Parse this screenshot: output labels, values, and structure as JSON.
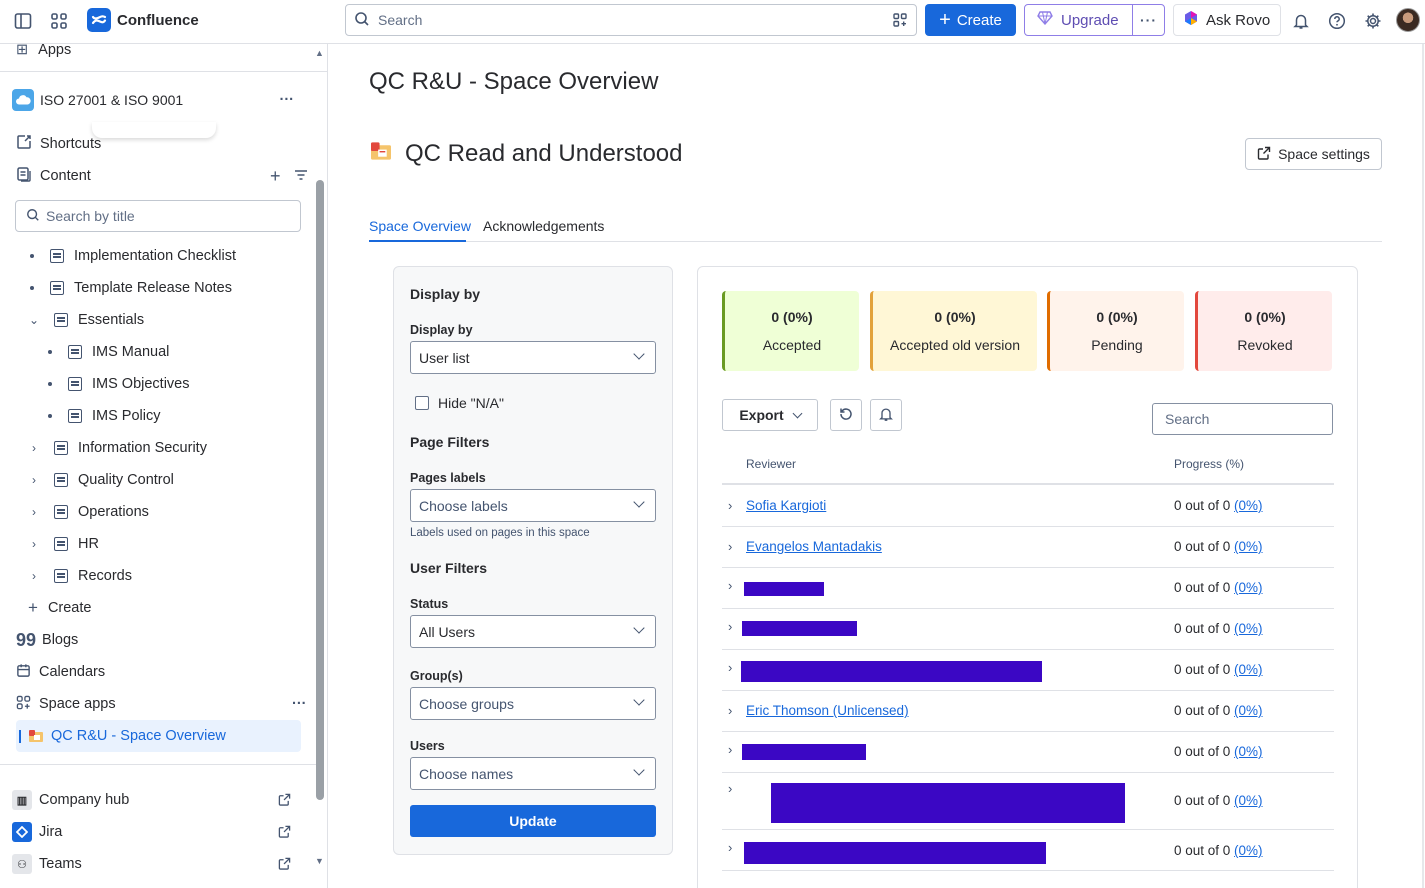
{
  "topbar": {
    "app_name": "Confluence",
    "search_placeholder": "Search",
    "create_label": "Create",
    "upgrade_label": "Upgrade",
    "more_label": "···",
    "rovo_label": "Ask Rovo"
  },
  "sidebar": {
    "apps_label": "Apps",
    "space_name": "ISO 27001 & ISO 9001",
    "space_more": "···",
    "shortcuts": "Shortcuts",
    "content": "Content",
    "search_placeholder": "Search by title",
    "tree": [
      {
        "label": "Implementation Checklist"
      },
      {
        "label": "Template Release Notes"
      },
      {
        "label": "Essentials"
      },
      {
        "label": "IMS Manual"
      },
      {
        "label": "IMS Objectives"
      },
      {
        "label": "IMS Policy"
      },
      {
        "label": "Information Security"
      },
      {
        "label": "Quality Control"
      },
      {
        "label": "Operations"
      },
      {
        "label": "HR"
      },
      {
        "label": "Records"
      }
    ],
    "create": "Create",
    "blogs": "Blogs",
    "calendars": "Calendars",
    "space_apps": "Space apps",
    "space_apps_more": "···",
    "active_item": "QC R&U - Space Overview",
    "company_hub": "Company hub",
    "jira": "Jira",
    "teams": "Teams"
  },
  "main": {
    "page_title": "QC R&U - Space Overview",
    "section_title": "QC Read and Understood",
    "space_settings": "Space settings",
    "tabs": [
      "Space Overview",
      "Acknowledgements"
    ],
    "active_tab": 0
  },
  "filters": {
    "heading": "Display by",
    "display_by_label": "Display by",
    "display_by_value": "User list",
    "hide_na": "Hide \"N/A\"",
    "page_filters": "Page Filters",
    "pages_labels": "Pages labels",
    "pages_labels_ph": "Choose labels",
    "labels_help": "Labels used on pages in this space",
    "user_filters": "User Filters",
    "status_label": "Status",
    "status_value": "All Users",
    "groups_label": "Group(s)",
    "groups_ph": "Choose groups",
    "users_label": "Users",
    "users_ph": "Choose names",
    "update": "Update"
  },
  "stats": [
    {
      "value": "0 (0%)",
      "label": "Accepted",
      "bg": "#efffd6",
      "border": "#6a9a23"
    },
    {
      "value": "0 (0%)",
      "label": "Accepted old version",
      "bg": "#fff7d6",
      "border": "#e2a23b"
    },
    {
      "value": "0 (0%)",
      "label": "Pending",
      "bg": "#fff3eb",
      "border": "#e06c00"
    },
    {
      "value": "0 (0%)",
      "label": "Revoked",
      "bg": "#ffeceb",
      "border": "#e2483d"
    }
  ],
  "toolbar": {
    "export": "Export",
    "search_placeholder": "Search"
  },
  "table": {
    "col_reviewer": "Reviewer",
    "col_progress": "Progress (%)",
    "rows": [
      {
        "name": "Sofia Kargioti",
        "progress": "0 out of 0 ",
        "pct": "(0%)"
      },
      {
        "name": "Evangelos Mantadakis",
        "progress": "0 out of 0 ",
        "pct": "(0%)"
      },
      {
        "name": "",
        "progress": "0 out of 0 ",
        "pct": "(0%)"
      },
      {
        "name": "",
        "progress": "0 out of 0 ",
        "pct": "(0%)"
      },
      {
        "name": "",
        "progress": "0 out of 0 ",
        "pct": "(0%)"
      },
      {
        "name": "Eric Thomson (Unlicensed)",
        "progress": "0 out of 0 ",
        "pct": "(0%)"
      },
      {
        "name": "",
        "progress": "0 out of 0 ",
        "pct": "(0%)"
      },
      {
        "name": "",
        "progress": "0 out of 0 ",
        "pct": "(0%)"
      },
      {
        "name": "",
        "progress": "0 out of 0 ",
        "pct": "(0%)"
      }
    ]
  },
  "colors": {
    "accent": "#1868db",
    "redaction": "#3b07c4"
  }
}
